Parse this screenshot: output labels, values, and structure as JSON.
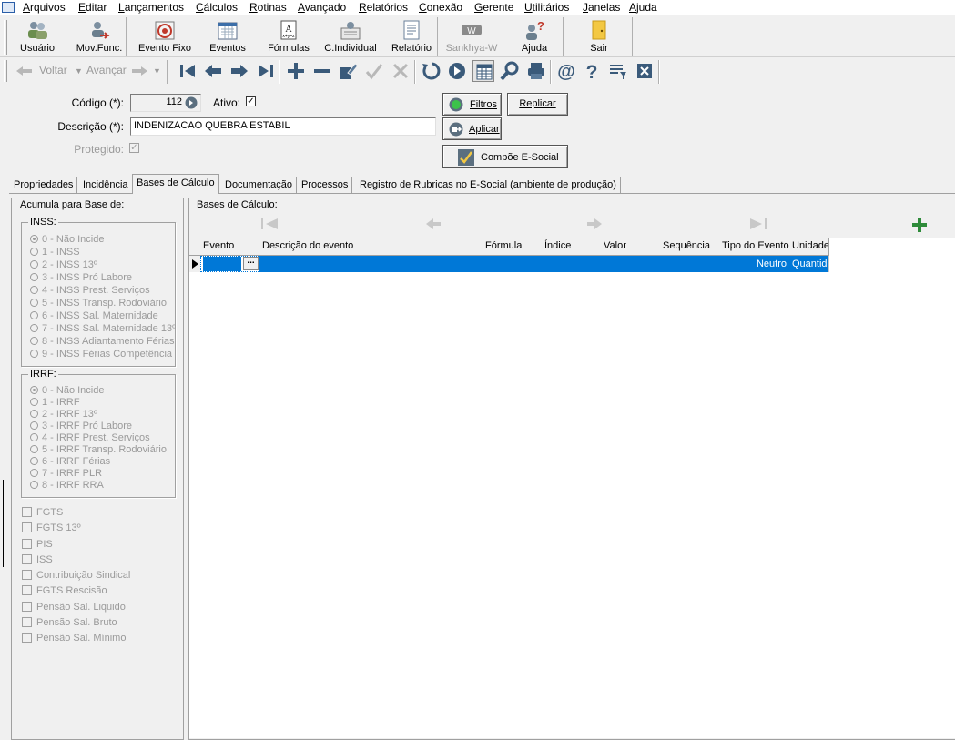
{
  "menu": [
    "Arquivos",
    "Editar",
    "Lançamentos",
    "Cálculos",
    "Rotinas",
    "Avançado",
    "Relatórios",
    "Conexão",
    "Gerente",
    "Utilitários",
    "Janelas",
    "Ajuda"
  ],
  "toolbar": {
    "usuario": "Usuário",
    "mov_func": "Mov.Func.",
    "evento_fixo": "Evento Fixo",
    "eventos": "Eventos",
    "formulas": "Fórmulas",
    "c_individual": "C.Individual",
    "relatorio": "Relatório",
    "sankhya": "Sankhya-W",
    "ajuda": "Ajuda",
    "sair": "Sair"
  },
  "nav": {
    "voltar": "Voltar",
    "avancar": "Avançar"
  },
  "form": {
    "codigo_label": "Código (*):",
    "codigo_value": "112",
    "ativo_label": "Ativo:",
    "ativo_checked": "✓",
    "descricao_label": "Descrição (*):",
    "descricao_value": "INDENIZACAO QUEBRA ESTABIL",
    "protegido_label": "Protegido:",
    "protegido_checked": "✓",
    "filtros": "Filtros",
    "aplicar": "Aplicar",
    "replicar": "Replicar",
    "compoe": "Compõe E-Social"
  },
  "tabs": [
    "Propriedades",
    "Incidência",
    "Bases de Cálculo",
    "Documentação",
    "Processos",
    "Registro de Rubricas no E-Social (ambiente de produção)"
  ],
  "acumula": {
    "title": "Acumula para Base de:",
    "inss_title": "INSS:",
    "inss": [
      "0 - Não Incide",
      "1 - INSS",
      "2 - INSS 13º",
      "3 - INSS Pró Labore",
      "4 - INSS Prest. Serviços",
      "5 - INSS Transp. Rodoviário",
      "6 - INSS Sal. Maternidade",
      "7 - INSS Sal. Maternidade 13º",
      "8 - INSS Adiantamento Férias",
      "9 - INSS Férias Competência"
    ],
    "irrf_title": "IRRF:",
    "irrf": [
      "0 - Não Incide",
      "1 - IRRF",
      "2 - IRRF 13º",
      "3 - IRRF Pró Labore",
      "4 - IRRF Prest. Serviços",
      "5 - IRRF Transp. Rodoviário",
      "6 - IRRF Férias",
      "7 - IRRF PLR",
      "8 - IRRF RRA"
    ],
    "checks": [
      "FGTS",
      "FGTS 13º",
      "PIS",
      "ISS",
      "Contribuição Sindical",
      "FGTS Rescisão",
      "Pensão Sal. Liquido",
      "Pensão Sal. Bruto",
      "Pensão Sal. Mínimo"
    ]
  },
  "bases": {
    "title": "Bases de Cálculo:",
    "columns": [
      "Evento",
      "Descrição do evento",
      "Fórmula",
      "Índice",
      "Valor",
      "Sequência",
      "Tipo do Evento",
      "Unidade"
    ],
    "row": {
      "evento": "",
      "ellipsis": "...",
      "tipo": "Neutro",
      "unidade": "Quantidade"
    }
  },
  "colors": {
    "selection": "#0078d7",
    "green_plus": "#2e8b3a"
  }
}
